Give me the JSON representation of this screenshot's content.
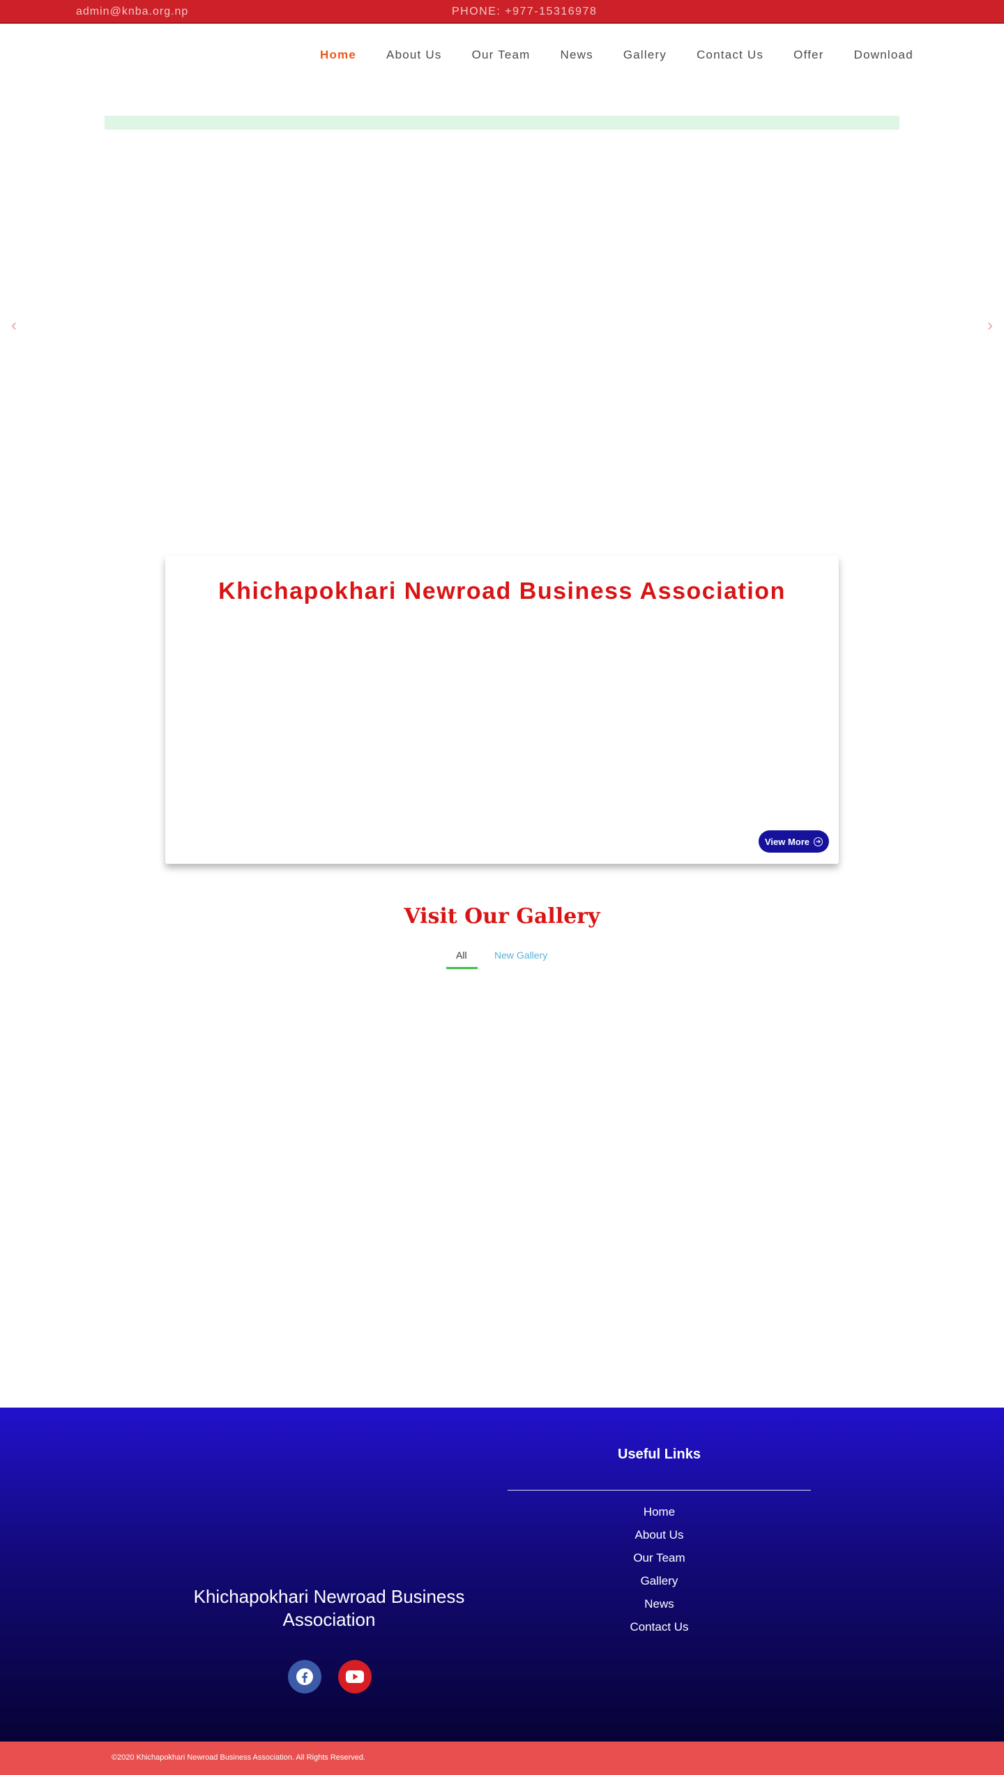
{
  "topbar": {
    "email": "admin@knba.org.np",
    "phone": "PHONE: +977-15316978"
  },
  "nav": {
    "items": [
      {
        "label": "Home",
        "active": true
      },
      {
        "label": "About Us"
      },
      {
        "label": "Our Team"
      },
      {
        "label": "News"
      },
      {
        "label": "Gallery"
      },
      {
        "label": "Contact Us"
      },
      {
        "label": "Offer"
      },
      {
        "label": "Download"
      }
    ]
  },
  "slider": {
    "prev_icon": "chevron-left-icon",
    "next_icon": "chevron-right-icon"
  },
  "about": {
    "title": "Khichapokhari Newroad Business Association",
    "button_label": "View More",
    "button_icon": "arrow-circle-right-icon"
  },
  "gallery": {
    "title": "Visit Our Gallery",
    "tabs": [
      "All",
      "New Gallery"
    ]
  },
  "footer": {
    "org_name": "Khichapokhari Newroad Business Association",
    "useful_links_title": "Useful Links",
    "useful_links": [
      "Home",
      "About Us",
      "Our Team",
      "Gallery",
      "News",
      "Contact Us"
    ],
    "social": [
      "facebook-icon",
      "youtube-icon"
    ]
  },
  "copyright": "©2020 Khichapokhari Newroad Business Association. All Rights Reserved.",
  "colors": {
    "topbar": "#cc2128",
    "nav_active": "#e9581c",
    "brand_red": "#d91414",
    "button_blue": "#16129c",
    "footer_top": "#2211cc",
    "footer_bottom": "#070335",
    "copyright_bar": "#e84f4f"
  }
}
